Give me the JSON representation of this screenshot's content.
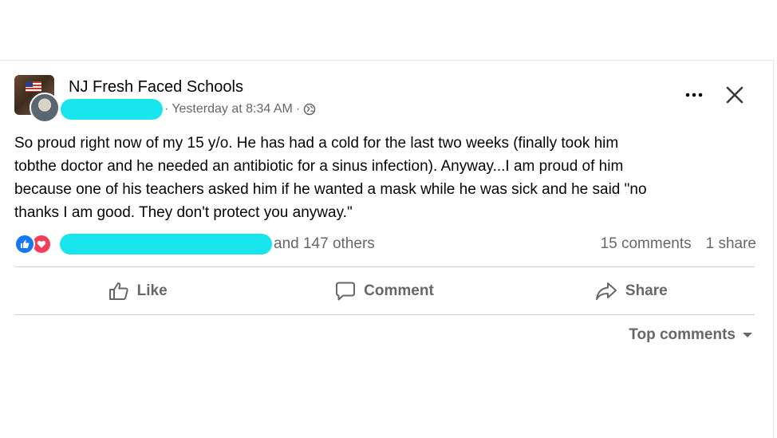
{
  "post": {
    "page_name": "NJ Fresh Faced Schools",
    "timestamp": "Yesterday at 8:34 AM",
    "separator_before": "·",
    "separator_after": "·",
    "privacy_icon": "globe-icon",
    "menu_icon": "ellipsis-icon",
    "close_icon": "close-icon",
    "text_lines": [
      "So proud right now of my 15 y/o.  He has had a cold for the last two weeks (finally took him",
      "tobthe doctor and he needed an antibiotic for a sinus infection).  Anyway...I am proud of him",
      "because one of his teachers asked him if he wanted a mask while he was sick and he said \"no",
      "thanks I am good. They don't protect you anyway.\""
    ]
  },
  "reactions": {
    "icons": [
      "like-reaction-icon",
      "love-reaction-icon"
    ],
    "others_text": "and 147 others",
    "comments": "15 comments",
    "shares": "1 share"
  },
  "actions": {
    "like": "Like",
    "comment": "Comment",
    "share": "Share"
  },
  "comments_sort": {
    "label": "Top comments",
    "icon": "caret-down-icon"
  },
  "colors": {
    "redaction": "#19e6ec",
    "like_blue": "#1877f2",
    "love_red": "#f33e58",
    "secondary_text": "#65676b"
  }
}
